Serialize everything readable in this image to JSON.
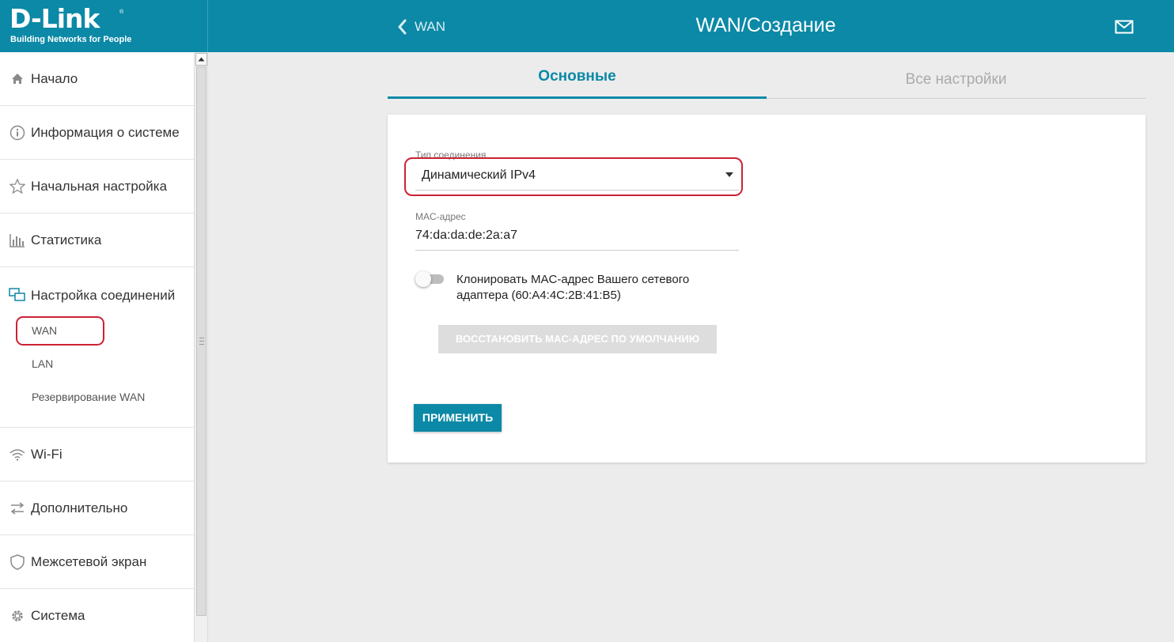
{
  "brand": {
    "logo_text": "D-Link",
    "registered_mark": "®",
    "tagline": "Building Networks for People"
  },
  "header": {
    "back_label": "WAN",
    "title": "WAN/Создание",
    "accent_color": "#0b89a6"
  },
  "sidebar": {
    "items": [
      {
        "label": "Начало",
        "icon": "home-icon"
      },
      {
        "label": "Информация о системе",
        "icon": "info-icon"
      },
      {
        "label": "Начальная настройка",
        "icon": "star-icon"
      },
      {
        "label": "Статистика",
        "icon": "bar-chart-icon"
      },
      {
        "label": "Настройка соединений",
        "icon": "connections-icon"
      },
      {
        "label": "Wi-Fi",
        "icon": "wifi-icon"
      },
      {
        "label": "Дополнительно",
        "icon": "transfer-arrows-icon"
      },
      {
        "label": "Межсетевой экран",
        "icon": "shield-icon"
      },
      {
        "label": "Система",
        "icon": "gear-icon"
      }
    ],
    "subitems": [
      {
        "label": "WAN",
        "selected": true
      },
      {
        "label": "LAN"
      },
      {
        "label": "Резервирование WAN"
      }
    ]
  },
  "tabs": [
    {
      "label": "Основные",
      "active": true
    },
    {
      "label": "Все настройки",
      "active": false
    }
  ],
  "form": {
    "connection_type_label": "Тип соединения",
    "connection_type_value": "Динамический IPv4",
    "mac_label": "MAC-адрес",
    "mac_value": "74:da:da:de:2a:a7",
    "clone_toggle_on": false,
    "clone_label": "Клонировать MAC-адрес Вашего сетевого адаптера (60:A4:4C:2B:41:B5)",
    "restore_button": "ВОССТАНОВИТЬ MAC-АДРЕС ПО УМОЛЧАНИЮ",
    "apply_button": "ПРИМЕНИТЬ"
  },
  "highlight_color": "#cc2233"
}
